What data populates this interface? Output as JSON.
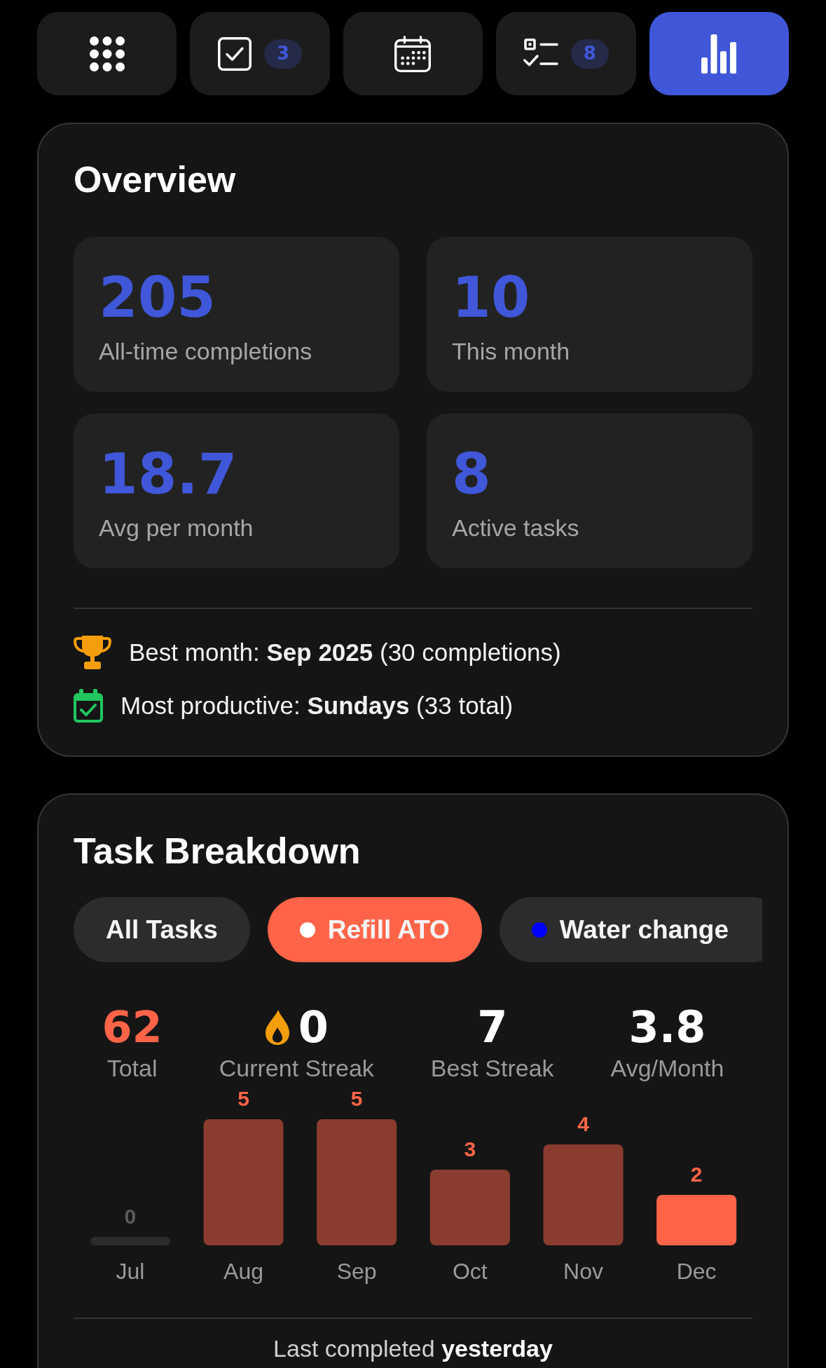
{
  "nav_tabs": [
    {
      "selected": false
    },
    {
      "badge": "3",
      "selected": false
    },
    {
      "selected": false
    },
    {
      "badge": "8",
      "selected": false
    },
    {
      "selected": true
    }
  ],
  "overview": {
    "title": "Overview",
    "stats": [
      {
        "value": "205",
        "label": "All-time completions"
      },
      {
        "value": "10",
        "label": "This month"
      },
      {
        "value": "18.7",
        "label": "Avg per month"
      },
      {
        "value": "8",
        "label": "Active tasks"
      }
    ],
    "highlights": [
      "Best month: **Sep 2025** (30 completions)",
      "Most productive: **Sundays** (33 total)"
    ]
  },
  "breakdown": {
    "title": "Task Breakdown",
    "filters": [
      {
        "label": "All Tasks",
        "selected": false
      },
      {
        "label": "Refill ATO",
        "color": "#ff6448",
        "selected": true
      },
      {
        "label": "Water change",
        "color": "#0000ff",
        "selected": false
      }
    ],
    "stats": [
      {
        "kind": "accent",
        "value": "62",
        "label": "Total"
      },
      {
        "kind": "streak",
        "value": "0",
        "label": "Current Streak"
      },
      {
        "kind": "plain",
        "value": "7",
        "label": "Best Streak"
      },
      {
        "kind": "plain",
        "value": "3.8",
        "label": "Avg/Month"
      }
    ],
    "chart_data": {
      "type": "bar",
      "categories": [
        "Jul",
        "Aug",
        "Sep",
        "Oct",
        "Nov",
        "Dec"
      ],
      "series": [
        {
          "color": "#ff6448",
          "values": [
            0,
            5,
            5,
            3,
            4,
            2
          ]
        }
      ],
      "data_labels": true
    },
    "bars": [
      {
        "highlighted": false
      },
      {
        "highlighted": false
      },
      {
        "highlighted": false
      },
      {
        "highlighted": false
      },
      {
        "highlighted": false
      },
      {
        "highlighted": true
      }
    ],
    "footer": "Last completed **yesterday**"
  }
}
